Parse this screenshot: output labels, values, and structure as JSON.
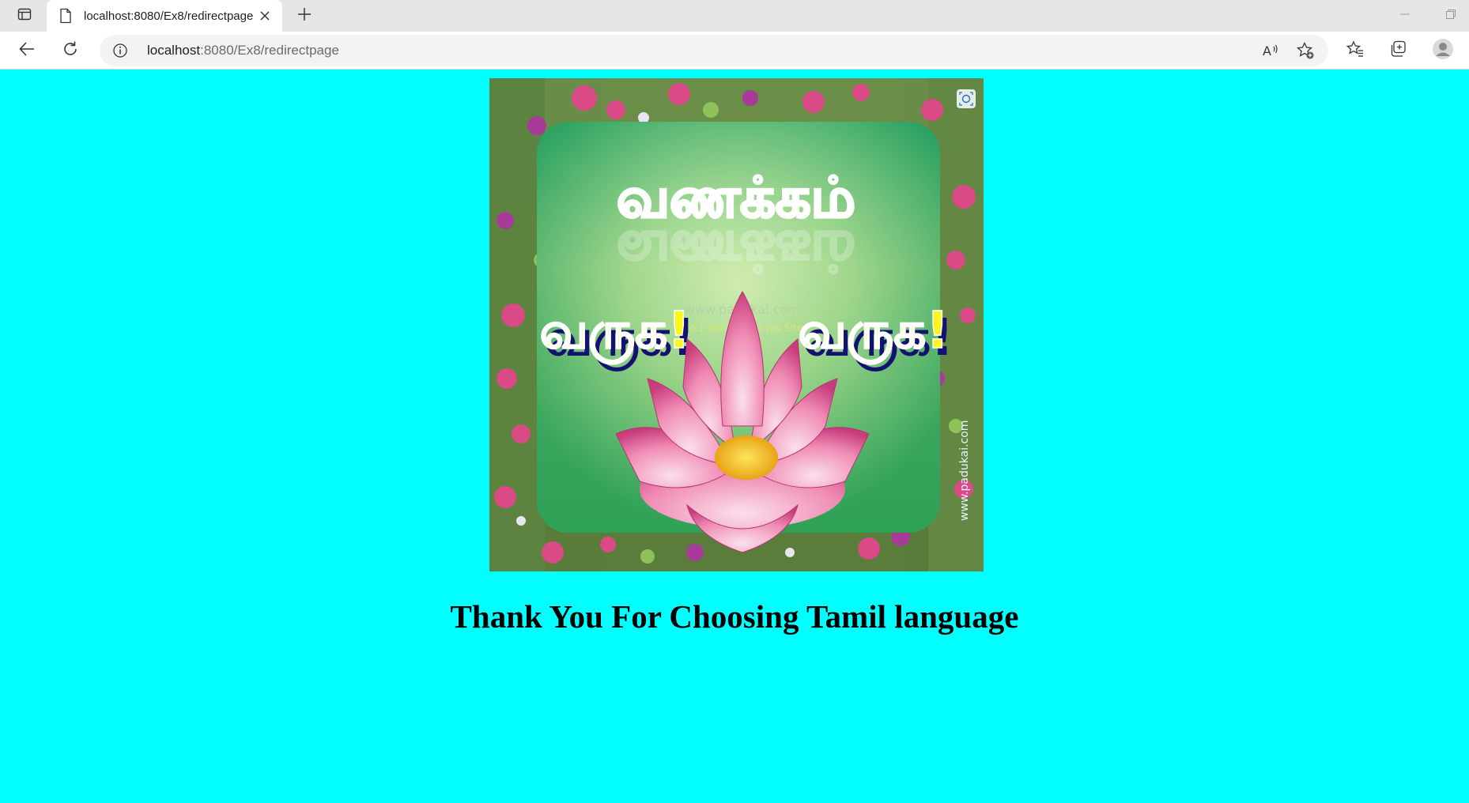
{
  "browser": {
    "tab_title": "localhost:8080/Ex8/redirectpage",
    "url_host": "localhost",
    "url_rest": ":8080/Ex8/redirectpage"
  },
  "image": {
    "title_text": "வணக்கம்",
    "welcome_left": "வருக!",
    "welcome_right": "வருக!",
    "watermark_site": "www.padukai.com",
    "watermark_tagline": "No.1 Tamil online job Site",
    "side_watermark": "www.padukai.com"
  },
  "page": {
    "heading": "Thank You For Choosing Tamil language"
  },
  "colors": {
    "page_background": "#00ffff",
    "tab_strip": "#e6e6e6"
  }
}
